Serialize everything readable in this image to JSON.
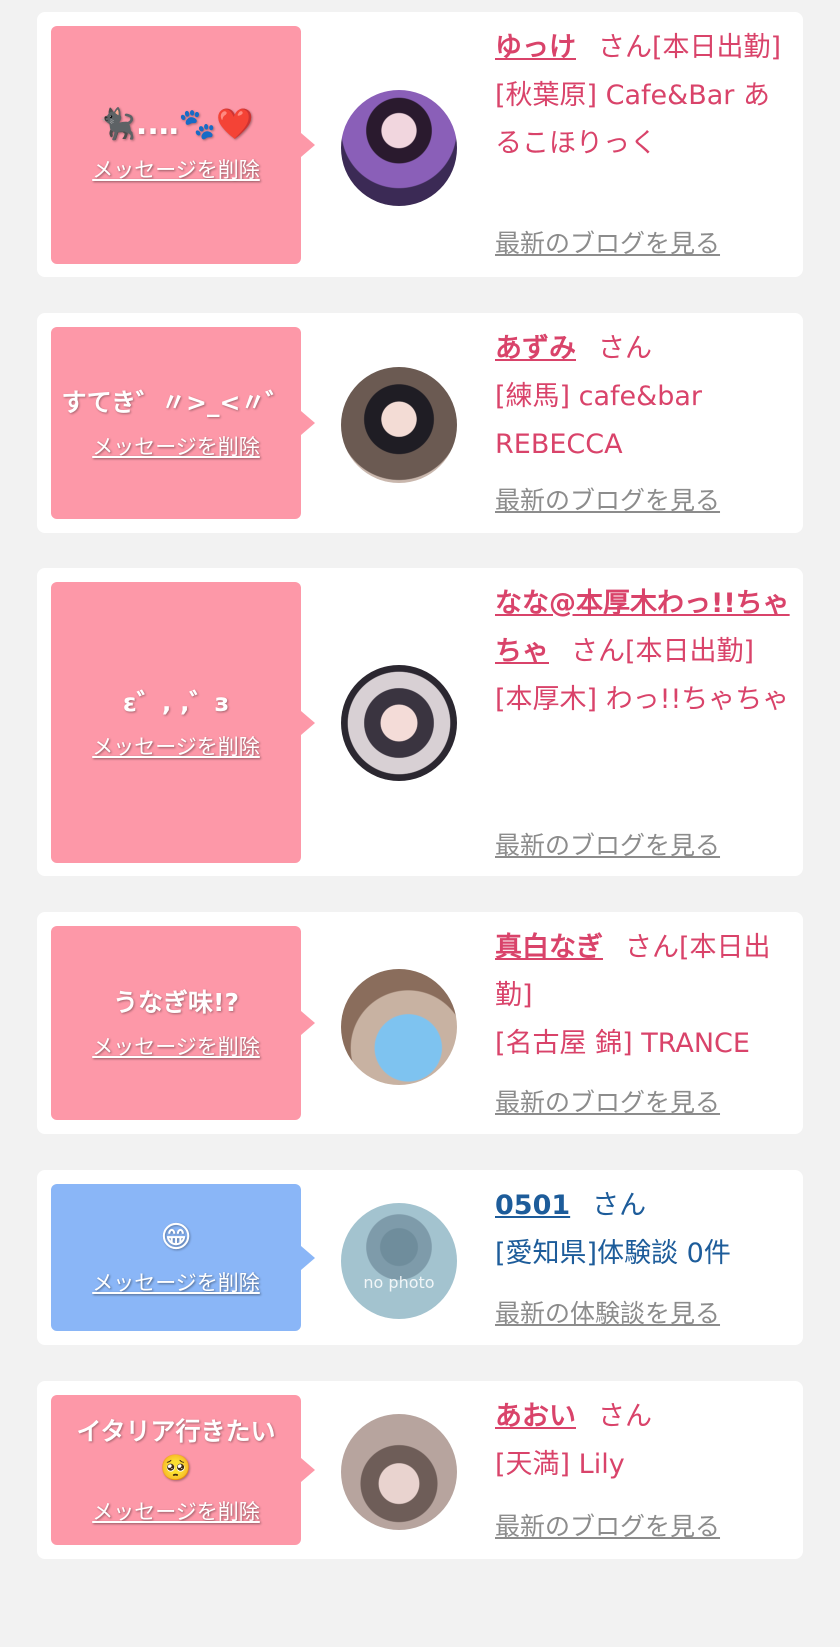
{
  "items": [
    {
      "message": "🐈‍⬛..‥🐾❤️",
      "delete": "メッセージを削除",
      "name": "ゆっけ",
      "suffix": "さん[本日出勤]",
      "shop": "[秋葉原] Cafe&Bar あるこほりっく",
      "link": "最新のブログを見る"
    },
    {
      "message": "すてき゛〃>_<〃゛",
      "delete": "メッセージを削除",
      "name": "あずみ",
      "suffix": "さん",
      "shop": "[練馬] cafe&bar REBECCA",
      "link": "最新のブログを見る"
    },
    {
      "message": "ε゛, ,゛з",
      "delete": "メッセージを削除",
      "name": "なな@本厚木わっ!!ちゃちゃ",
      "suffix": "さん[本日出勤]",
      "shop": "[本厚木] わっ!!ちゃちゃ",
      "link": "最新のブログを見る"
    },
    {
      "message": "うなぎ味!?",
      "delete": "メッセージを削除",
      "name": "真白なぎ",
      "suffix": "さん[本日出勤]",
      "shop": "[名古屋 錦] TRANCE",
      "link": "最新のブログを見る"
    },
    {
      "message": "😁",
      "delete": "メッセージを削除",
      "name": "0501",
      "suffix": "さん",
      "shop": "[愛知県]体験談 0件",
      "link": "最新の体験談を見る",
      "avatar_label": "no photo"
    },
    {
      "message": "イタリア行きたい🥺",
      "delete": "メッセージを削除",
      "name": "あおい",
      "suffix": "さん",
      "shop": "[天満] Lily",
      "link": "最新のブログを見る"
    }
  ],
  "colors": {
    "pink_bubble": "#fd98a8",
    "blue_bubble": "#8ab6f7",
    "name_pink": "#d9436a",
    "name_navy": "#1d5c9a",
    "link_gray": "#8c8c8c"
  }
}
